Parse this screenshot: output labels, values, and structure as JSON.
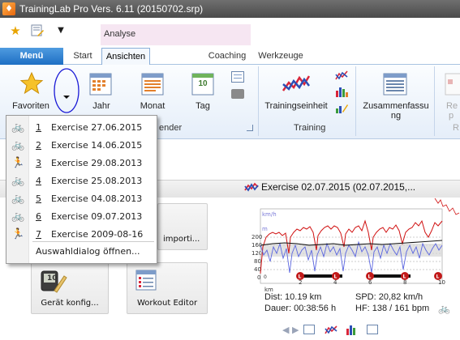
{
  "window": {
    "title": "TrainingLab Pro Vers. 6.11 (20150702.srp)"
  },
  "quick_access": {
    "icons": [
      "star-icon",
      "edit-icon",
      "dropdown-arrow-icon"
    ]
  },
  "context_group": {
    "label": "Analyse"
  },
  "menu_button": {
    "label": "Menü"
  },
  "tabs": [
    {
      "label": "Start"
    },
    {
      "label": "Ansichten",
      "active": true
    },
    {
      "label": "Coaching"
    },
    {
      "label": "Werkzeuge"
    }
  ],
  "ribbon": {
    "favoriten": {
      "label": "Favoriten"
    },
    "calendar": {
      "jahr": "Jahr",
      "monat": "Monat",
      "tag": "Tag",
      "tag_icon_text": "10",
      "group_label": "ender"
    },
    "training": {
      "einheit": "Trainingseinheit",
      "group_label": "Training"
    },
    "zusammenfassung": {
      "label": "Zusammenfassu",
      "label2": "ng"
    },
    "partial": {
      "label": "Re",
      "label2": "p",
      "group_label": "R"
    }
  },
  "favorites_menu": {
    "items": [
      {
        "num": "1",
        "text": "Exercise 27.06.2015",
        "icon": "bike-icon"
      },
      {
        "num": "2",
        "text": "Exercise 14.06.2015",
        "icon": "bike-icon"
      },
      {
        "num": "3",
        "text": "Exercise 29.08.2013",
        "icon": "runner-icon"
      },
      {
        "num": "4",
        "text": "Exercise 25.08.2013",
        "icon": "bike-icon"
      },
      {
        "num": "5",
        "text": "Exercise 04.08.2013",
        "icon": "bike-icon"
      },
      {
        "num": "6",
        "text": "Exercise 09.07.2013",
        "icon": "bike-icon"
      },
      {
        "num": "7",
        "text": "Exercise 2009-08-16",
        "icon": "runner-icon"
      }
    ],
    "footer": "Auswahldialog öffnen..."
  },
  "tiles": {
    "import": "importi...",
    "geraet": "Gerät konfig...",
    "workout": "Workout Editor",
    "device_icon_text": "10"
  },
  "exercise": {
    "title": "Exercise 02.07.2015 (02.07.2015,...",
    "chart_units": [
      "km/h",
      "m"
    ],
    "y_ticks": [
      "200",
      "160",
      "120",
      "80",
      "40",
      "0"
    ],
    "x_ticks": [
      "0",
      "2",
      "4",
      "6",
      "8",
      "10"
    ],
    "x_unit": "km",
    "lap_markers": [
      "L",
      "L",
      "L",
      "L",
      "L"
    ],
    "dist": "Dist: 10.19 km",
    "spd": "SPD: 20,82 km/h",
    "dauer": "Dauer: 00:38:56 h",
    "hf": "HF: 138 / 161 bpm"
  },
  "colors": {
    "accent": "#1e6fc4",
    "hr_red": "#d01010",
    "speed_blue": "#5b66e0",
    "highlight_circle": "#1a1ad6"
  }
}
